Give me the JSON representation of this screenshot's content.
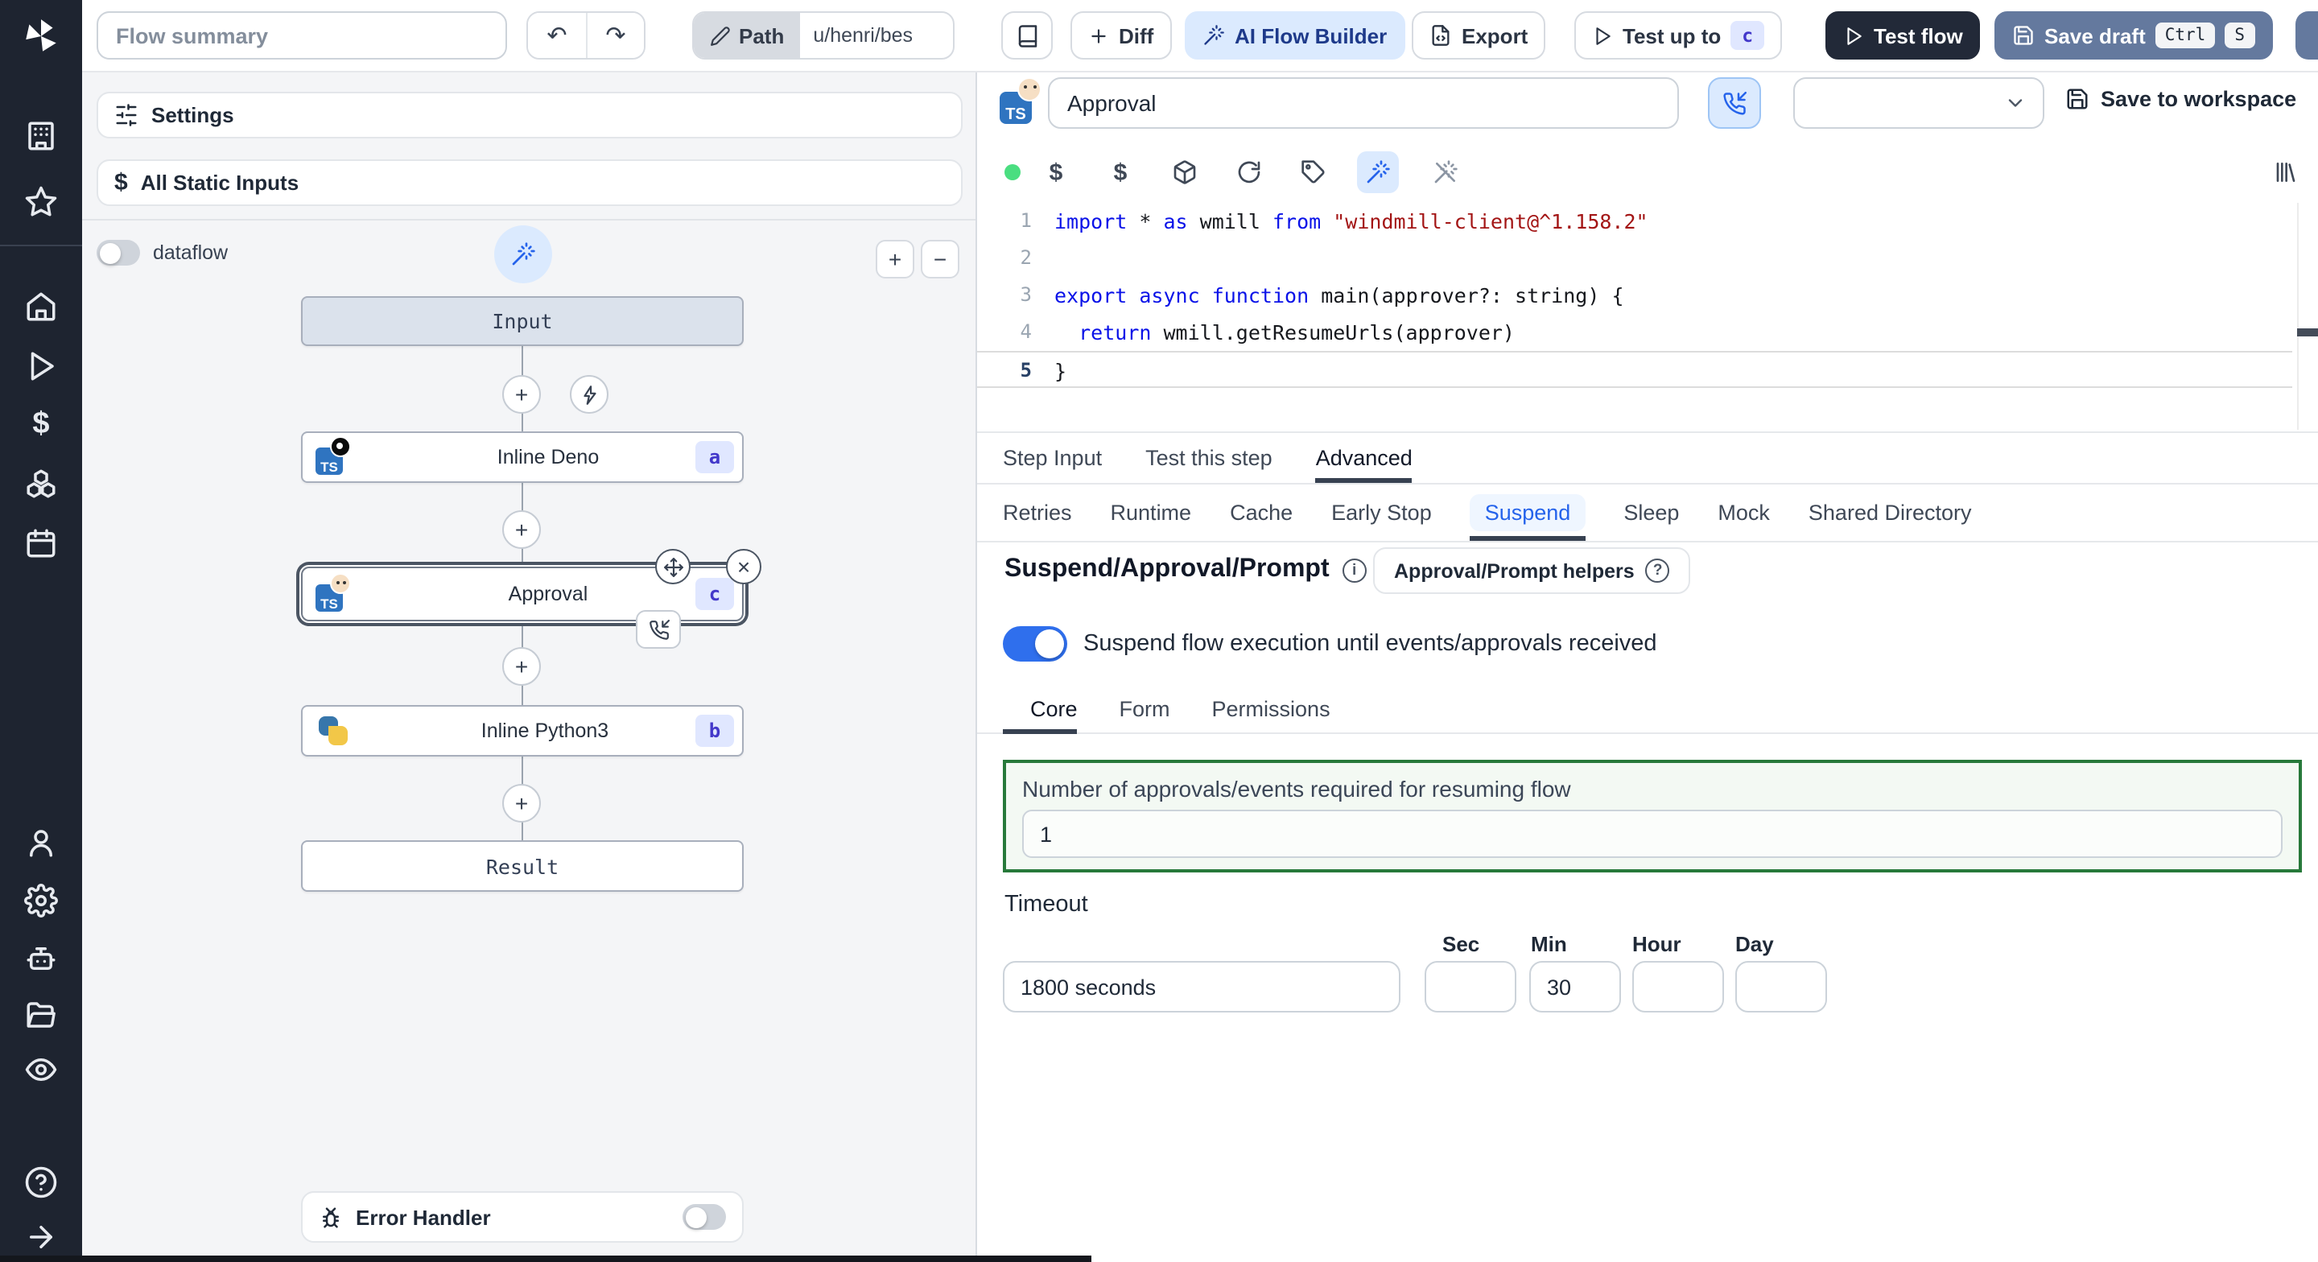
{
  "icons": {
    "undo": "↶",
    "redo": "↷",
    "plus": "+",
    "minus": "−",
    "close": "×",
    "dollar": "$",
    "info": "i",
    "question": "?",
    "ts_label": "TS"
  },
  "topbar": {
    "flow_summary_placeholder": "Flow summary",
    "path_label": "Path",
    "path_value": "u/henri/bes",
    "diff_label": "Diff",
    "ai_flow_builder_label": "AI Flow Builder",
    "export_label": "Export",
    "test_up_to_label": "Test up to",
    "test_up_to_badge": "c",
    "test_flow_label": "Test flow",
    "save_draft_label": "Save draft",
    "save_draft_kbd1": "Ctrl",
    "save_draft_kbd2": "S"
  },
  "sidebar_icons": [
    "windmill-logo",
    "building",
    "star",
    "home",
    "play",
    "dollar",
    "blocks",
    "calendar",
    "user",
    "settings",
    "worker",
    "folder",
    "eye",
    "help",
    "collapse-arrow"
  ],
  "left_panel": {
    "settings_label": "Settings",
    "all_static_inputs_label": "All Static Inputs",
    "dataflow_label": "dataflow",
    "error_handler_label": "Error Handler"
  },
  "graph": {
    "input_node_label": "Input",
    "result_node_label": "Result",
    "nodes": [
      {
        "label": "Inline Deno",
        "badge": "a"
      },
      {
        "label": "Approval",
        "badge": "c"
      },
      {
        "label": "Inline Python3",
        "badge": "b"
      }
    ]
  },
  "step_panel": {
    "title_value": "Approval",
    "save_to_workspace_label": "Save to workspace",
    "code": {
      "active_line": 5,
      "lines": [
        [
          {
            "t": "import",
            "c": "kw"
          },
          {
            "t": " * ",
            "c": "pl"
          },
          {
            "t": "as",
            "c": "kw"
          },
          {
            "t": " wmill ",
            "c": "pl"
          },
          {
            "t": "from",
            "c": "kw"
          },
          {
            "t": " ",
            "c": "pl"
          },
          {
            "t": "\"windmill-client@^1.158.2\"",
            "c": "str"
          }
        ],
        [],
        [
          {
            "t": "export",
            "c": "kw"
          },
          {
            "t": " ",
            "c": "pl"
          },
          {
            "t": "async",
            "c": "kw"
          },
          {
            "t": " ",
            "c": "pl"
          },
          {
            "t": "function",
            "c": "kw"
          },
          {
            "t": " main(approver?: string) {",
            "c": "pl"
          }
        ],
        [
          {
            "t": "  ",
            "c": "pl"
          },
          {
            "t": "return",
            "c": "kw"
          },
          {
            "t": " wmill.getResumeUrls(approver)",
            "c": "pl"
          }
        ],
        [
          {
            "t": "}",
            "c": "pl"
          }
        ]
      ]
    },
    "tabs": [
      "Step Input",
      "Test this step",
      "Advanced"
    ],
    "advanced_tabs": [
      "Retries",
      "Runtime",
      "Cache",
      "Early Stop",
      "Suspend",
      "Sleep",
      "Mock",
      "Shared Directory"
    ],
    "suspend": {
      "heading": "Suspend/Approval/Prompt",
      "helpers_button_label": "Approval/Prompt helpers",
      "toggle_label": "Suspend flow execution until events/approvals received",
      "sub_tabs": [
        "Core",
        "Form",
        "Permissions"
      ],
      "approvals_label": "Number of approvals/events required for resuming flow",
      "approvals_value": "1",
      "timeout_label": "Timeout",
      "timeout_value": "1800 seconds",
      "timeout_units": [
        {
          "label": "Sec",
          "value": ""
        },
        {
          "label": "Min",
          "value": "30"
        },
        {
          "label": "Hour",
          "value": ""
        },
        {
          "label": "Day",
          "value": ""
        }
      ]
    }
  }
}
